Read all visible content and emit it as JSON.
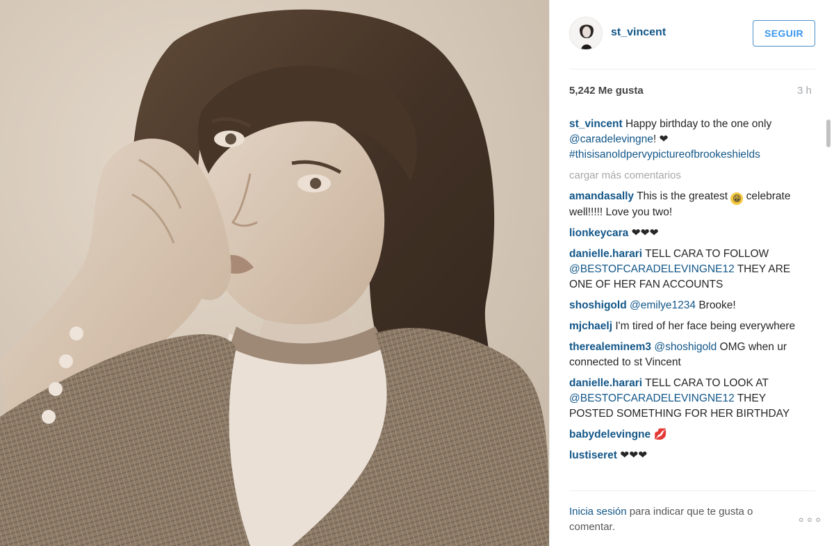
{
  "post": {
    "username": "st_vincent",
    "follow_label": "SEGUIR",
    "likes": "5,242 Me gusta",
    "time_ago": "3 h",
    "caption": {
      "user": "st_vincent",
      "text_before": "Happy birthday to the one only ",
      "mention": "@caradelevingne",
      "text_after": "! ",
      "heart": "❤",
      "hashtag": "#thisisanoldpervypictureofbrookeshields"
    },
    "load_more": "cargar más comentarios",
    "comments": [
      {
        "user": "amandasally",
        "text": "This is the greatest",
        "emoji": "😁",
        "text2": "celebrate well!!!!! Love you two!"
      },
      {
        "user": "lionkeycara",
        "text": "❤❤❤"
      },
      {
        "user": "danielle.harari",
        "text": "TELL CARA TO FOLLOW",
        "mention": "@BESTOFCARADELEVINGNE12",
        "text2": "THEY ARE ONE OF HER FAN ACCOUNTS"
      },
      {
        "user": "shoshigold",
        "mention": "@emilye1234",
        "text2": "Brooke!"
      },
      {
        "user": "mjchaelj",
        "text": "I'm tired of her face being everywhere"
      },
      {
        "user": "therealeminem3",
        "mention": "@shoshigold",
        "text2": "OMG when ur connected to st Vincent"
      },
      {
        "user": "danielle.harari",
        "text": "TELL CARA TO LOOK AT",
        "mention": "@BESTOFCARADELEVINGNE12",
        "text2": "THEY POSTED SOMETHING FOR HER BIRTHDAY"
      },
      {
        "user": "babydelevingne",
        "emoji": "💋"
      },
      {
        "user": "lustiseret",
        "text": "❤❤❤"
      }
    ],
    "login_prompt": {
      "link": "Inicia sesión",
      "text": " para indicar que te gusta o comentar."
    },
    "more_icon": "ellipsis-icon",
    "colors": {
      "username_blue": "#125688",
      "follow_blue": "#3897f0",
      "muted_gray": "#a5a7aa"
    }
  }
}
